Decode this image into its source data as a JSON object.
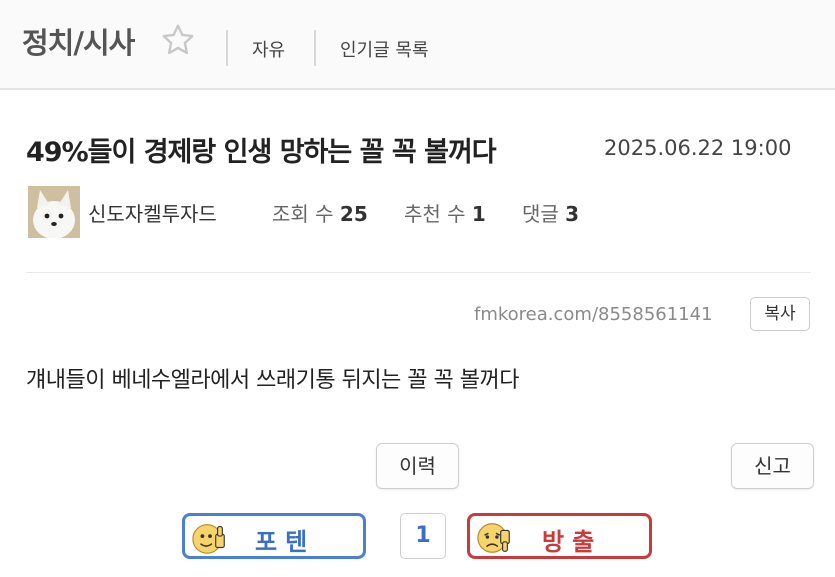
{
  "header": {
    "board_title": "정치/시사",
    "links": [
      "자유",
      "인기글 목록"
    ]
  },
  "post": {
    "title": "49%들이 경제랑 인생 망하는 꼴 꼭 볼꺼다",
    "date": "2025.06.22 19:00",
    "author": "신도자켈투자드",
    "views_label": "조회 수",
    "views": "25",
    "recommend_label": "추천 수",
    "recommend": "1",
    "comments_label": "댓글",
    "comments": "3",
    "url": "fmkorea.com/8558561141",
    "copy_label": "복사",
    "body": "걔내들이 베네수엘라에서 쓰래기통 뒤지는 꼴 꼭 볼꺼다"
  },
  "actions": {
    "history_label": "이력",
    "report_label": "신고"
  },
  "vote": {
    "up_label": "포텐",
    "count": "1",
    "down_label": "방출"
  },
  "colors": {
    "up_accent": "#4a7fd6",
    "down_accent": "#c93a3a"
  }
}
